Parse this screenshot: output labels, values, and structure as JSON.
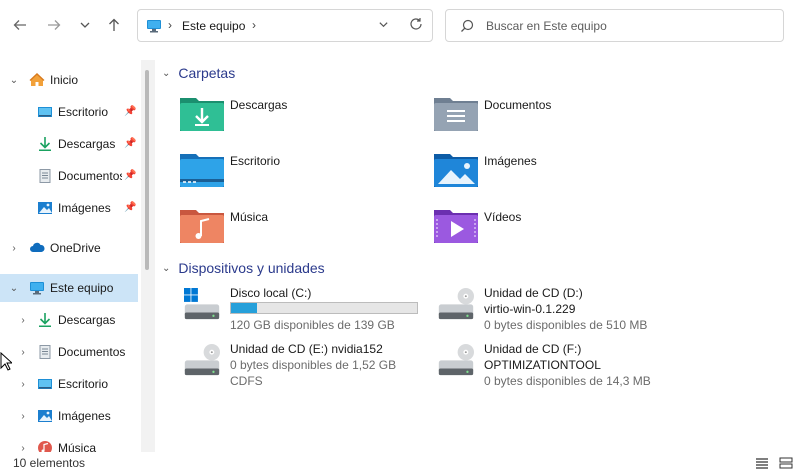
{
  "toolbar": {
    "back_icon": "arrow-left-icon",
    "forward_icon": "arrow-right-icon",
    "recent_icon": "chevron-down-icon",
    "up_icon": "arrow-up-icon"
  },
  "address": {
    "location": "Este equipo",
    "refresh_icon": "refresh-icon"
  },
  "search": {
    "placeholder": "Buscar en Este equipo"
  },
  "sidebar": {
    "items": [
      {
        "label": "Inicio",
        "icon": "home-icon",
        "pinned": false
      },
      {
        "label": "Escritorio",
        "icon": "desktop-icon",
        "pinned": true
      },
      {
        "label": "Descargas",
        "icon": "download-icon",
        "pinned": true
      },
      {
        "label": "Documentos",
        "icon": "document-icon",
        "pinned": true
      },
      {
        "label": "Imágenes",
        "icon": "pictures-icon",
        "pinned": true
      },
      {
        "label": "OneDrive",
        "icon": "cloud-icon",
        "pinned": false
      },
      {
        "label": "Este equipo",
        "icon": "computer-icon",
        "pinned": false,
        "selected": true
      },
      {
        "label": "Descargas",
        "icon": "download-icon",
        "pinned": false
      },
      {
        "label": "Documentos",
        "icon": "document-icon",
        "pinned": false
      },
      {
        "label": "Escritorio",
        "icon": "desktop-icon",
        "pinned": false
      },
      {
        "label": "Imágenes",
        "icon": "pictures-icon",
        "pinned": false
      },
      {
        "label": "Música",
        "icon": "music-icon",
        "pinned": false
      }
    ]
  },
  "main": {
    "folders_header": "Carpetas",
    "folders": [
      {
        "label": "Descargas",
        "icon": "downloads-folder-icon"
      },
      {
        "label": "Documentos",
        "icon": "documents-folder-icon"
      },
      {
        "label": "Escritorio",
        "icon": "desktop-folder-icon"
      },
      {
        "label": "Imágenes",
        "icon": "pictures-folder-icon"
      },
      {
        "label": "Música",
        "icon": "music-folder-icon"
      },
      {
        "label": "Vídeos",
        "icon": "videos-folder-icon"
      }
    ],
    "drives_header": "Dispositivos y unidades",
    "drives": [
      {
        "name": "Disco local (C:)",
        "sub": "120 GB disponibles de 139 GB",
        "used_fraction": 0.14,
        "icon": "hard-drive-icon"
      },
      {
        "name": "Unidad de CD (D:)",
        "sub": "virtio-win-0.1.229",
        "sub2": "0 bytes disponibles de 510 MB",
        "icon": "cd-drive-icon"
      },
      {
        "name": "Unidad de CD (E:) nvidia152",
        "sub": "0 bytes disponibles de 1,52 GB",
        "sub2": "CDFS",
        "icon": "cd-drive-icon"
      },
      {
        "name": "Unidad de CD (F:)",
        "sub": "OPTIMIZATIONTOOL",
        "sub2": "0 bytes disponibles de 14,3 MB",
        "icon": "cd-drive-icon"
      }
    ]
  },
  "status": {
    "count": "10 elementos"
  },
  "colors": {
    "accent": "#0078d4",
    "selection": "#cce4f7",
    "header": "#2b3a8c",
    "bar_fill": "#26a0da"
  }
}
